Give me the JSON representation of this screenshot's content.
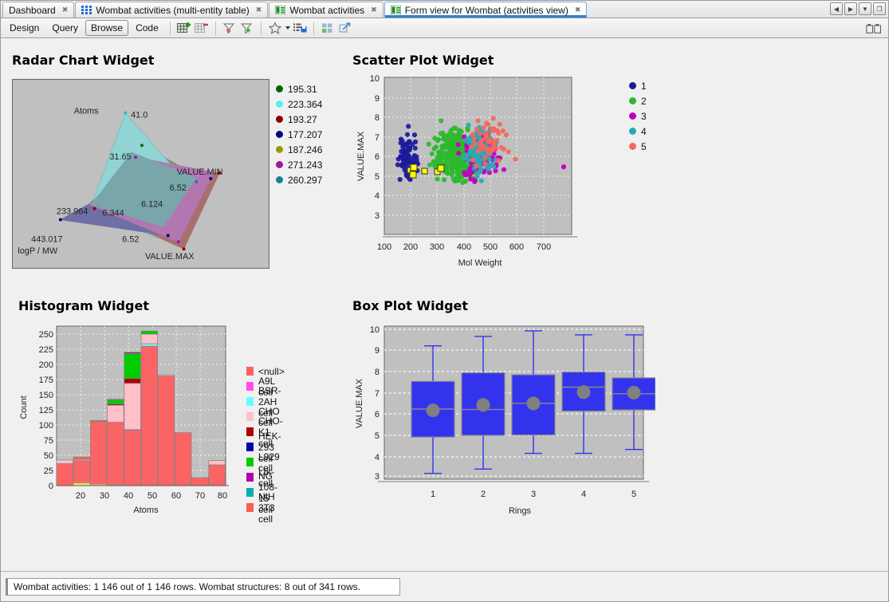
{
  "window": {
    "controls": [
      {
        "name": "scroll-tabs-left",
        "glyph": "◀"
      },
      {
        "name": "scroll-tabs-right",
        "glyph": "▶"
      },
      {
        "name": "tab-list-dropdown",
        "glyph": "▼"
      },
      {
        "name": "restore-window",
        "glyph": "❐"
      }
    ]
  },
  "tabs": [
    {
      "label": "Dashboard",
      "icon": "none",
      "active": false,
      "close": "✖"
    },
    {
      "label": "Wombat activities (multi-entity table)",
      "icon": "grid-icon",
      "active": false,
      "close": "✖"
    },
    {
      "label": "Wombat activities",
      "icon": "form-icon",
      "active": false,
      "close": "✖"
    },
    {
      "label": "Form view for Wombat (activities view)",
      "icon": "form-icon",
      "active": true,
      "close": "✖"
    }
  ],
  "toolbar": {
    "modes": [
      {
        "label": "Design",
        "active": false
      },
      {
        "label": "Query",
        "active": false
      },
      {
        "label": "Browse",
        "active": true
      },
      {
        "label": "Code",
        "active": false
      }
    ],
    "icons": [
      {
        "name": "add-table-icon"
      },
      {
        "name": "remove-table-icon"
      },
      {
        "name": "filter-clear-icon"
      },
      {
        "name": "filter-add-icon"
      },
      {
        "name": "favorites-star-icon"
      },
      {
        "name": "save-list-icon"
      },
      {
        "name": "layout-grid-icon"
      },
      {
        "name": "export-icon"
      }
    ],
    "right_icon": {
      "name": "dual-panel-icon"
    }
  },
  "widgets": {
    "radar": {
      "title": "Radar Chart Widget"
    },
    "scatter": {
      "title": "Scatter Plot Widget"
    },
    "histogram": {
      "title": "Histogram Widget"
    },
    "boxplot": {
      "title": "Box Plot Widget"
    }
  },
  "status": {
    "text": "Wombat activities: 1 146 out of 1 146 rows. Wombat structures: 8 out of 341 rows."
  },
  "chart_data": [
    {
      "type": "radar",
      "title": "Radar Chart Widget",
      "axes": [
        "Atoms",
        "VALUE.MIN",
        "VALUE.MAX",
        "logP / MW"
      ],
      "axis_value_labels": [
        {
          "axis": "Atoms",
          "label": "41.0"
        },
        {
          "axis": "Atoms",
          "label": "31.65"
        },
        {
          "axis": "VALUE.MIN",
          "label": "6.52"
        },
        {
          "axis": "VALUE.MIN",
          "label": "6.124"
        },
        {
          "axis": "VALUE.MAX",
          "label": "6.52"
        },
        {
          "axis": "VALUE.MAX",
          "label": "6.344"
        },
        {
          "axis": "logP / MW",
          "label": "443.017"
        },
        {
          "axis": "logP / MW",
          "label": "233.964"
        }
      ],
      "legend_position": "right",
      "series": [
        {
          "name": "195.31",
          "color": "#008000",
          "values": [
            0.62,
            0.8,
            0.46,
            0.28
          ]
        },
        {
          "name": "223.364",
          "color": "#55eeee",
          "values": [
            1.0,
            0.58,
            0.4,
            0.3
          ]
        },
        {
          "name": "193.27",
          "color": "#8b0000",
          "values": [
            0.4,
            1.0,
            1.0,
            0.33
          ]
        },
        {
          "name": "177.207",
          "color": "#000080",
          "values": [
            0.34,
            0.86,
            0.6,
            1.0
          ]
        },
        {
          "name": "187.246",
          "color": "#999900",
          "values": [
            0.38,
            0.52,
            0.35,
            0.31
          ]
        },
        {
          "name": "271.243",
          "color": "#a0159b",
          "values": [
            0.73,
            0.9,
            0.78,
            0.34
          ]
        },
        {
          "name": "260.297",
          "color": "#19838f",
          "values": [
            0.75,
            0.62,
            0.41,
            0.3
          ]
        }
      ]
    },
    {
      "type": "scatter",
      "title": "Scatter Plot Widget",
      "xlabel": "Mol Weight",
      "ylabel": "VALUE.MAX",
      "xticks": [
        100,
        200,
        300,
        400,
        500,
        600,
        700
      ],
      "yticks": [
        3,
        4,
        5,
        6,
        7,
        8,
        9,
        10
      ],
      "xlim": [
        60,
        760
      ],
      "ylim": [
        2.7,
        10.3
      ],
      "grid": true,
      "legend_position": "right",
      "legend": [
        {
          "label": "1",
          "color": "#1a1a9c"
        },
        {
          "label": "2",
          "color": "#2eb82e"
        },
        {
          "label": "3",
          "color": "#c000c0"
        },
        {
          "label": "4",
          "color": "#2aa9b5"
        },
        {
          "label": "5",
          "color": "#f4685c"
        }
      ],
      "selected_marker_color": "#ffff00",
      "selected_points": [
        {
          "x": 175,
          "y": 6.35
        },
        {
          "x": 188,
          "y": 6.47
        },
        {
          "x": 190,
          "y": 6.22
        },
        {
          "x": 208,
          "y": 6.3
        },
        {
          "x": 258,
          "y": 6.33
        },
        {
          "x": 270,
          "y": 6.38
        }
      ],
      "n_points": 1146
    },
    {
      "type": "bar",
      "subtype": "stacked-histogram",
      "title": "Histogram Widget",
      "xlabel": "Atoms",
      "ylabel": "Count",
      "xticks": [
        20,
        30,
        40,
        50,
        60,
        70,
        80
      ],
      "yticks": [
        0,
        25,
        50,
        75,
        100,
        125,
        150,
        175,
        200,
        225,
        250
      ],
      "ylim": [
        0,
        262
      ],
      "bin_centers": [
        17,
        24,
        31,
        38,
        45,
        52,
        59,
        66,
        73,
        80
      ],
      "grid": true,
      "legend_position": "right",
      "series": [
        {
          "name": "<null>",
          "color": "#fa6464",
          "values": [
            36,
            41,
            105,
            104,
            91,
            229,
            180,
            87,
            13,
            34
          ]
        },
        {
          "name": "A9L cell",
          "color": "#ff4df0",
          "values": [
            0,
            0,
            0,
            0,
            1,
            0,
            0,
            0,
            0,
            0
          ]
        },
        {
          "name": "BSR-2AH cell",
          "color": "#66ffff",
          "values": [
            0,
            0,
            0,
            0,
            0,
            4,
            0,
            0,
            0,
            0
          ]
        },
        {
          "name": "CHO cell",
          "color": "#ffc0c8",
          "values": [
            6,
            2,
            0,
            28,
            76,
            16,
            2,
            0,
            0,
            7
          ]
        },
        {
          "name": "CHO-K1 cell",
          "color": "#b00000",
          "values": [
            0,
            0,
            0,
            2,
            8,
            0,
            0,
            0,
            0,
            0
          ]
        },
        {
          "name": "HEK-293 cell",
          "color": "#0000b0",
          "values": [
            0,
            0,
            0,
            0,
            0,
            0,
            0,
            0,
            0,
            0
          ]
        },
        {
          "name": "L929 cell",
          "color": "#00cc00",
          "values": [
            0,
            0,
            0,
            7,
            41,
            5,
            0,
            0,
            0,
            0
          ]
        },
        {
          "name": "Ltk- cell",
          "color": "#b000b0",
          "values": [
            0,
            0,
            0,
            0,
            2,
            0,
            0,
            0,
            0,
            0
          ]
        },
        {
          "name": "NG 108-15 cell",
          "color": "#00b0b0",
          "values": [
            0,
            0,
            0,
            0,
            0,
            0,
            0,
            0,
            0,
            0
          ]
        },
        {
          "name": "NIH 3T3 cell",
          "color": "#f86050",
          "values": [
            0,
            4,
            2,
            1,
            0,
            0,
            0,
            0,
            0,
            0
          ]
        }
      ]
    },
    {
      "type": "boxplot",
      "title": "Box Plot Widget",
      "xlabel": "Rings",
      "ylabel": "VALUE.MAX",
      "categories": [
        "1",
        "2",
        "3",
        "4",
        "5"
      ],
      "yticks": [
        3,
        4,
        5,
        6,
        7,
        8,
        9,
        10
      ],
      "ylim": [
        2.75,
        10.15
      ],
      "grid": true,
      "box_color": "#3333ee",
      "mean_marker_color": "#808080",
      "boxes": [
        {
          "category": "1",
          "min": 3.03,
          "q1": 4.79,
          "median": 6.14,
          "q3": 7.48,
          "max": 9.2,
          "mean": 6.08
        },
        {
          "category": "2",
          "min": 3.24,
          "q1": 4.87,
          "median": 6.12,
          "q3": 7.89,
          "max": 9.65,
          "mean": 6.34
        },
        {
          "category": "3",
          "min": 4.0,
          "q1": 4.89,
          "median": 6.42,
          "q3": 7.8,
          "max": 9.92,
          "mean": 6.41
        },
        {
          "category": "4",
          "min": 4.0,
          "q1": 6.04,
          "median": 7.2,
          "q3": 7.93,
          "max": 9.73,
          "mean": 6.96
        },
        {
          "category": "5",
          "min": 4.19,
          "q1": 6.1,
          "median": 6.88,
          "q3": 7.65,
          "max": 9.73,
          "mean": 6.93
        }
      ]
    }
  ]
}
